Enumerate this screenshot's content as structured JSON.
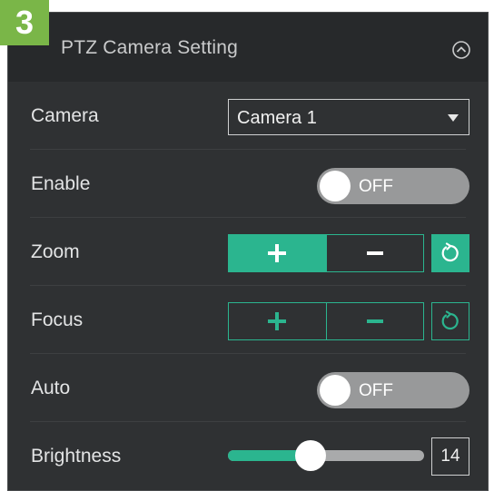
{
  "badge": {
    "text": "3",
    "color": "#7ab648"
  },
  "header": {
    "title": "PTZ Camera Setting",
    "collapse_icon": "chevron-up-circle-icon"
  },
  "camera": {
    "label": "Camera",
    "selected": "Camera 1"
  },
  "enable": {
    "label": "Enable",
    "state": "OFF"
  },
  "zoom": {
    "label": "Zoom",
    "plus": "+",
    "minus": "−",
    "reset_icon": "reset-icon"
  },
  "focus": {
    "label": "Focus",
    "plus": "+",
    "minus": "−",
    "reset_icon": "reset-icon"
  },
  "auto": {
    "label": "Auto",
    "state": "OFF"
  },
  "brightness": {
    "label": "Brightness",
    "value": "14",
    "fraction": 0.42
  },
  "colors": {
    "accent": "#2bb58f",
    "panel": "#2f3133",
    "header": "#27292b"
  }
}
